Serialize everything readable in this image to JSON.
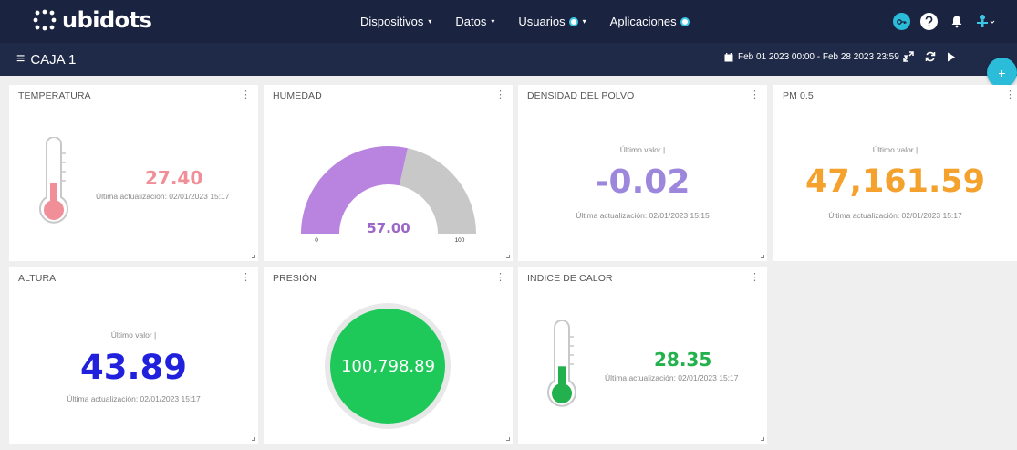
{
  "header": {
    "logo_text": "ubidots",
    "nav": [
      {
        "label": "Dispositivos",
        "caret": "▾"
      },
      {
        "label": "Datos",
        "caret": "▾"
      },
      {
        "label": "Usuarios",
        "caret": "▾"
      },
      {
        "label": "Aplicaciones"
      }
    ]
  },
  "toolbar": {
    "menu_glyph": "≡",
    "dashboard_title": "CAJA 1",
    "date_range": "Feb 01 2023 00:00 - Feb 28 2023 23:59",
    "date_caret": "▾"
  },
  "fab_label": "+",
  "widgets": {
    "temperatura": {
      "title": "TEMPERATURA",
      "value": "27.40",
      "updated": "Última actualización: 02/01/2023 15:17",
      "fill": 0.35,
      "color": "#f08f98"
    },
    "humedad": {
      "title": "HUMEDAD",
      "value": "57.00",
      "min": "0",
      "max": "100",
      "fraction": 0.57,
      "color": "#b984e0",
      "track": "#c8c8c8"
    },
    "densidad": {
      "title": "DENSIDAD DEL POLVO",
      "caption": "Último valor |",
      "value": "-0.02",
      "updated": "Última actualización: 02/01/2023 15:15",
      "color": "#9c87dd"
    },
    "pm05": {
      "title": "PM 0.5",
      "caption": "Último valor |",
      "value": "47,161.59",
      "updated": "Última actualización: 02/01/2023 15:17",
      "color": "#f4a22d"
    },
    "altura": {
      "title": "ALTURA",
      "caption": "Último valor |",
      "value": "43.89",
      "updated": "Última actualización: 02/01/2023 15:17",
      "color": "#2020dd"
    },
    "presion": {
      "title": "PRESIÓN",
      "value": "100,798.89",
      "color": "#1ec95a"
    },
    "calor": {
      "title": "INDICE DE CALOR",
      "value": "28.35",
      "updated": "Última actualización: 02/01/2023 15:17",
      "fill": 0.35,
      "color": "#22b14c"
    }
  },
  "colors": {
    "header_bg": "#1a2340",
    "subbar_bg": "#1f2a48",
    "accent": "#2bbcd9"
  }
}
